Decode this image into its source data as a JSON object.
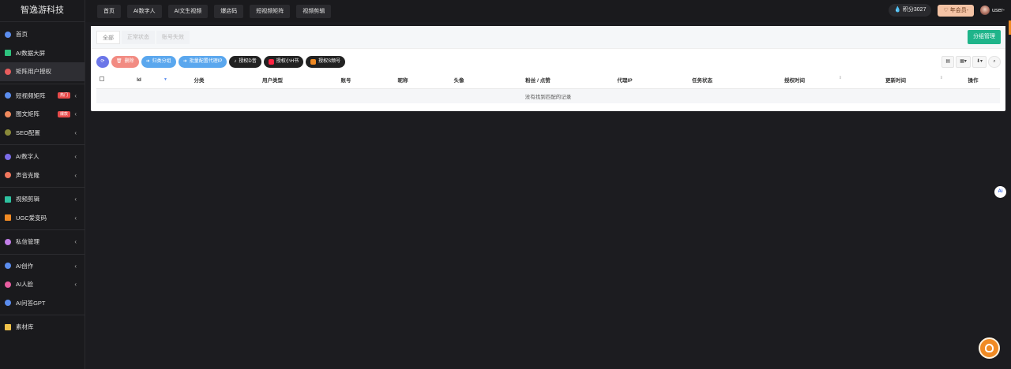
{
  "brand": "智逸游科技",
  "sidebar": {
    "items": [
      {
        "label": "首页",
        "icon": "home-icon",
        "color": "#5b8def",
        "chev": false
      },
      {
        "label": "AI数据大屏",
        "icon": "monitor-icon",
        "color": "#2ec27e",
        "chev": false
      },
      {
        "label": "矩阵用户授权",
        "icon": "user-auth-icon",
        "color": "#e85d5d",
        "chev": false,
        "active": true
      },
      {
        "label": "短视频矩阵",
        "icon": "video-icon",
        "color": "#5b8def",
        "chev": true,
        "badge": "热门"
      },
      {
        "label": "图文矩阵",
        "icon": "image-text-icon",
        "color": "#f08a5d",
        "chev": true,
        "badge": "爆款"
      },
      {
        "label": "SEO配置",
        "icon": "seo-icon",
        "color": "#8a8a3a",
        "chev": true
      },
      {
        "label": "AI数字人",
        "icon": "digital-human-icon",
        "color": "#7b6ce8",
        "chev": true
      },
      {
        "label": "声音克隆",
        "icon": "voice-icon",
        "color": "#f0765d",
        "chev": true
      },
      {
        "label": "视频剪辑",
        "icon": "video-edit-icon",
        "color": "#2ec2a0",
        "chev": true
      },
      {
        "label": "UGC爱变码",
        "icon": "ugc-icon",
        "color": "#f08a24",
        "chev": true
      },
      {
        "label": "私信管理",
        "icon": "message-icon",
        "color": "#c27ee8",
        "chev": true
      },
      {
        "label": "AI创作",
        "icon": "ai-create-icon",
        "color": "#5b8def",
        "chev": true
      },
      {
        "label": "AI人脸",
        "icon": "ai-face-icon",
        "color": "#e85da0",
        "chev": true
      },
      {
        "label": "AI问答GPT",
        "icon": "gpt-icon",
        "color": "#5b8def",
        "chev": false
      },
      {
        "label": "素材库",
        "icon": "folder-icon",
        "color": "#f0c24a",
        "chev": false
      }
    ]
  },
  "topnav": {
    "tabs": [
      "首页",
      "AI数字人",
      "AI文生视频",
      "爆店码",
      "短视频矩阵",
      "视频剪辑"
    ],
    "points": "积分3027",
    "vip": "年会员-",
    "user": "user-"
  },
  "panel": {
    "tabs": [
      "全部",
      "正常状态",
      "账号失效"
    ],
    "group_button": "分组管理",
    "toolbar": {
      "delete": "删除",
      "group": "归类分组",
      "proxy": "批量配置代理IP",
      "douyin": "授权D音",
      "xhs": "授权小H书",
      "kuaishou": "授权S频号"
    },
    "table": {
      "headers": [
        "",
        "Id",
        "分类",
        "用户类型",
        "账号",
        "昵称",
        "头像",
        "粉丝 / 点赞",
        "代理IP",
        "任务状态",
        "授权时间",
        "更新时间",
        "操作"
      ],
      "empty": "没有找到匹配的记录"
    }
  },
  "floating": {
    "ai": "Ai"
  }
}
